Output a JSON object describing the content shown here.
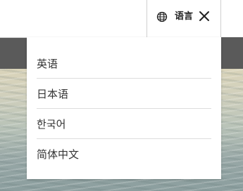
{
  "header": {
    "language_label": "语言",
    "icons": {
      "globe": "globe-icon",
      "close": "close-icon"
    }
  },
  "language_menu": {
    "items": [
      {
        "label": "英语"
      },
      {
        "label": "日本语"
      },
      {
        "label": "한국어"
      },
      {
        "label": "简体中文"
      }
    ]
  },
  "colors": {
    "topbar_bg": "#ffffff",
    "dark_band": "#5a5a5a",
    "text": "#333333",
    "divider": "#dddddd"
  }
}
